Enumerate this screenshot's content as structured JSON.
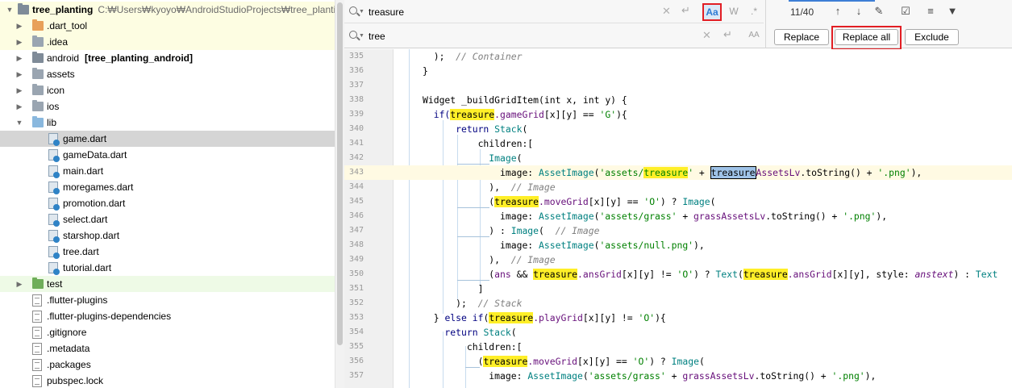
{
  "project": {
    "root": {
      "name": "tree_planting",
      "path": "C:₩Users₩kyoyo₩AndroidStudioProjects₩tree_plantin"
    },
    "items": [
      {
        "label": ".dart_tool",
        "indent": 1,
        "kind": "folder",
        "color": "#e8a05a",
        "expandable": true,
        "bg": "yellow"
      },
      {
        "label": ".idea",
        "indent": 1,
        "kind": "folder",
        "color": "#9aa5b1",
        "expandable": true,
        "bg": "yellow"
      },
      {
        "label": "android",
        "suffix": "[tree_planting_android]",
        "indent": 1,
        "kind": "folder",
        "color": "#7f8b98",
        "expandable": true,
        "bg": "none"
      },
      {
        "label": "assets",
        "indent": 1,
        "kind": "folder",
        "color": "#9aa5b1",
        "expandable": true,
        "bg": "none"
      },
      {
        "label": "icon",
        "indent": 1,
        "kind": "folder",
        "color": "#9aa5b1",
        "expandable": true,
        "bg": "none"
      },
      {
        "label": "ios",
        "indent": 1,
        "kind": "folder",
        "color": "#9aa5b1",
        "expandable": true,
        "bg": "none"
      },
      {
        "label": "lib",
        "indent": 1,
        "kind": "folder",
        "color": "#8ab8de",
        "expandable": true,
        "expanded": true,
        "bg": "none"
      },
      {
        "label": "game.dart",
        "indent": 2,
        "kind": "dart",
        "bg": "selected"
      },
      {
        "label": "gameData.dart",
        "indent": 2,
        "kind": "dart",
        "bg": "none"
      },
      {
        "label": "main.dart",
        "indent": 2,
        "kind": "dart",
        "bg": "none"
      },
      {
        "label": "moregames.dart",
        "indent": 2,
        "kind": "dart",
        "bg": "none"
      },
      {
        "label": "promotion.dart",
        "indent": 2,
        "kind": "dart",
        "bg": "none"
      },
      {
        "label": "select.dart",
        "indent": 2,
        "kind": "dart",
        "bg": "none"
      },
      {
        "label": "starshop.dart",
        "indent": 2,
        "kind": "dart",
        "bg": "none"
      },
      {
        "label": "tree.dart",
        "indent": 2,
        "kind": "dart",
        "bg": "none"
      },
      {
        "label": "tutorial.dart",
        "indent": 2,
        "kind": "dart",
        "bg": "none"
      },
      {
        "label": "test",
        "indent": 1,
        "kind": "folder",
        "color": "#6fae5a",
        "expandable": true,
        "bg": "green"
      },
      {
        "label": ".flutter-plugins",
        "indent": 1,
        "kind": "file",
        "bg": "none"
      },
      {
        "label": ".flutter-plugins-dependencies",
        "indent": 1,
        "kind": "file",
        "bg": "none"
      },
      {
        "label": ".gitignore",
        "indent": 1,
        "kind": "file",
        "bg": "none"
      },
      {
        "label": ".metadata",
        "indent": 1,
        "kind": "file",
        "bg": "none"
      },
      {
        "label": ".packages",
        "indent": 1,
        "kind": "file",
        "bg": "none"
      },
      {
        "label": "pubspec.lock",
        "indent": 1,
        "kind": "file",
        "bg": "none"
      }
    ]
  },
  "search": {
    "find_value": "treasure",
    "replace_value": "tree",
    "match_case_label": "Aa",
    "words_label": "W",
    "regex_label": ".*",
    "preserve_case_label": "AA",
    "counter": "11/40",
    "replace_label": "Replace",
    "replace_all_label": "Replace all",
    "exclude_label": "Exclude",
    "accent_color": "#2d7bd4",
    "highlight_color": "#e21e24"
  },
  "editor": {
    "lines": [
      {
        "n": "335",
        "tokens": [
          [
            "",
            "  );  "
          ],
          [
            "cmt",
            "// Container"
          ]
        ]
      },
      {
        "n": "336",
        "tokens": [
          [
            "",
            "}"
          ]
        ]
      },
      {
        "n": "337",
        "tokens": []
      },
      {
        "n": "338",
        "tokens": [
          [
            "",
            "Widget "
          ],
          [
            "",
            "_buildGridItem(int x, int y) {"
          ]
        ]
      },
      {
        "n": "339",
        "tokens": [
          [
            "kw",
            "  if("
          ],
          [
            "m",
            "treasure"
          ],
          [
            "fld",
            ".gameGrid"
          ],
          [
            "",
            "[x][y] == "
          ],
          [
            "str",
            "'G'"
          ],
          [
            "",
            "){"
          ]
        ]
      },
      {
        "n": "340",
        "tokens": [
          [
            "kw",
            "      return "
          ],
          [
            "cls",
            "Stack"
          ],
          [
            "",
            "("
          ]
        ]
      },
      {
        "n": "341",
        "tokens": [
          [
            "",
            "          children:["
          ]
        ]
      },
      {
        "n": "342",
        "tokens": [
          [
            "cls",
            "            Image"
          ],
          [
            "",
            "("
          ]
        ]
      },
      {
        "n": "343",
        "current": true,
        "tokens": [
          [
            "",
            "              image: "
          ],
          [
            "cls",
            "AssetImage"
          ],
          [
            "",
            "("
          ],
          [
            "str",
            "'assets/"
          ],
          [
            "m str",
            "treasure"
          ],
          [
            "str",
            "'"
          ],
          [
            "",
            " + "
          ],
          [
            "m-cur",
            "treasure"
          ],
          [
            "fld",
            "AssetsLv"
          ],
          [
            "",
            ".toString() + "
          ],
          [
            "str",
            "'.png'"
          ],
          [
            "",
            "),"
          ]
        ]
      },
      {
        "n": "344",
        "tokens": [
          [
            "",
            "            ),  "
          ],
          [
            "cmt",
            "// Image"
          ]
        ]
      },
      {
        "n": "345",
        "tokens": [
          [
            "",
            "            ("
          ],
          [
            "m",
            "treasure"
          ],
          [
            "fld",
            ".moveGrid"
          ],
          [
            "",
            "[x][y] == "
          ],
          [
            "str",
            "'O'"
          ],
          [
            "",
            ") ? "
          ],
          [
            "cls",
            "Image"
          ],
          [
            "",
            "("
          ]
        ]
      },
      {
        "n": "346",
        "tokens": [
          [
            "",
            "              image: "
          ],
          [
            "cls",
            "AssetImage"
          ],
          [
            "",
            "("
          ],
          [
            "str",
            "'assets/grass'"
          ],
          [
            "",
            " + "
          ],
          [
            "fld",
            "grassAssetsLv"
          ],
          [
            "",
            ".toString() + "
          ],
          [
            "str",
            "'.png'"
          ],
          [
            "",
            "),"
          ]
        ]
      },
      {
        "n": "347",
        "tokens": [
          [
            "",
            "            ) : "
          ],
          [
            "cls",
            "Image"
          ],
          [
            "",
            "(  "
          ],
          [
            "cmt",
            "// Image"
          ]
        ]
      },
      {
        "n": "348",
        "tokens": [
          [
            "",
            "              image: "
          ],
          [
            "cls",
            "AssetImage"
          ],
          [
            "",
            "("
          ],
          [
            "str",
            "'assets/null.png'"
          ],
          [
            "",
            "),"
          ]
        ]
      },
      {
        "n": "349",
        "tokens": [
          [
            "",
            "            ),  "
          ],
          [
            "cmt",
            "// Image"
          ]
        ]
      },
      {
        "n": "350",
        "tokens": [
          [
            "",
            "            ("
          ],
          [
            "fld",
            "ans"
          ],
          [
            "",
            " && "
          ],
          [
            "m",
            "treasure"
          ],
          [
            "fld",
            ".ansGrid"
          ],
          [
            "",
            "[x][y] != "
          ],
          [
            "str",
            "'O'"
          ],
          [
            "",
            ") ? "
          ],
          [
            "cls",
            "Text"
          ],
          [
            "",
            "("
          ],
          [
            "m",
            "treasure"
          ],
          [
            "fld",
            ".ansGrid"
          ],
          [
            "",
            "[x][y], style: "
          ],
          [
            "it",
            "anstext"
          ],
          [
            "",
            ") : "
          ],
          [
            "cls",
            "Text"
          ]
        ]
      },
      {
        "n": "351",
        "tokens": [
          [
            "",
            "          ]"
          ]
        ]
      },
      {
        "n": "352",
        "tokens": [
          [
            "",
            "      );  "
          ],
          [
            "cmt",
            "// Stack"
          ]
        ]
      },
      {
        "n": "353",
        "tokens": [
          [
            "",
            "  } "
          ],
          [
            "kw",
            "else if"
          ],
          [
            "",
            "("
          ],
          [
            "m",
            "treasure"
          ],
          [
            "fld",
            ".playGrid"
          ],
          [
            "",
            "[x][y] != "
          ],
          [
            "str",
            "'O'"
          ],
          [
            "",
            "){"
          ]
        ]
      },
      {
        "n": "354",
        "tokens": [
          [
            "kw",
            "    return "
          ],
          [
            "cls",
            "Stack"
          ],
          [
            "",
            "("
          ]
        ]
      },
      {
        "n": "355",
        "tokens": [
          [
            "",
            "        children:["
          ]
        ]
      },
      {
        "n": "356",
        "tokens": [
          [
            "",
            "          ("
          ],
          [
            "m",
            "treasure"
          ],
          [
            "fld",
            ".moveGrid"
          ],
          [
            "",
            "[x][y] == "
          ],
          [
            "str",
            "'O'"
          ],
          [
            "",
            ") ? "
          ],
          [
            "cls",
            "Image"
          ],
          [
            "",
            "("
          ]
        ]
      },
      {
        "n": "357",
        "tokens": [
          [
            "",
            "            image: "
          ],
          [
            "cls",
            "AssetImage"
          ],
          [
            "",
            "("
          ],
          [
            "str",
            "'assets/grass'"
          ],
          [
            "",
            " + "
          ],
          [
            "fld",
            "grassAssetsLv"
          ],
          [
            "",
            ".toString() + "
          ],
          [
            "str",
            "'.png'"
          ],
          [
            "",
            "),"
          ]
        ]
      }
    ]
  }
}
